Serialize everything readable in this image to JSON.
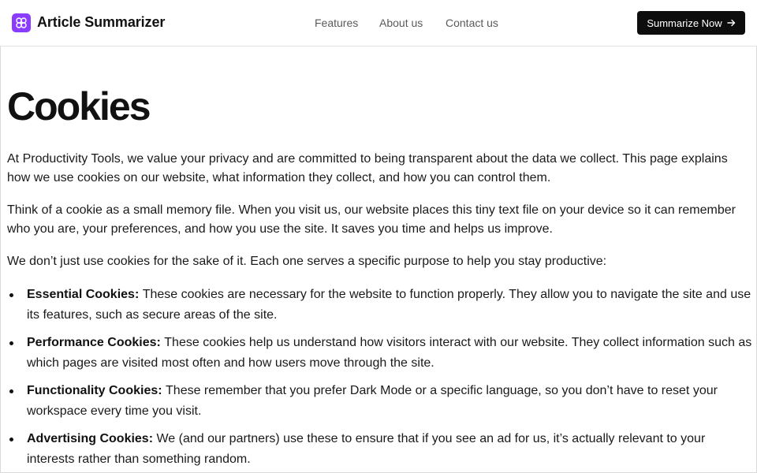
{
  "brand": {
    "name": "Article Summarizer",
    "logo_icon": "brain-icon",
    "logo_color": "#8b3dff"
  },
  "nav": {
    "links": [
      {
        "label": "Features"
      },
      {
        "label": "About us"
      },
      {
        "label": "Contact us"
      }
    ]
  },
  "cta": {
    "label": "Summarize Now",
    "icon": "arrow-right-icon"
  },
  "page": {
    "title": "Cookies",
    "paragraphs": [
      "At Productivity Tools, we value your privacy and are committed to being transparent about the data we collect. This page explains how we use cookies on our website, what information they collect, and how you can control them.",
      "Think of a cookie as a small memory file. When you visit us, our website places this tiny text file on your device so it can remember who you are, your preferences, and how you use the site. It saves you time and helps us improve.",
      "We don’t just use cookies for the sake of it. Each one serves a specific purpose to help you stay productive:"
    ],
    "cookie_types": [
      {
        "name": "Essential Cookies:",
        "description": "These cookies are necessary for the website to function properly. They allow you to navigate the site and use its features, such as secure areas of the site."
      },
      {
        "name": "Performance Cookies:",
        "description": "These cookies help us understand how visitors interact with our website. They collect information such as which pages are visited most often and how users move through the site."
      },
      {
        "name": "Functionality Cookies:",
        "description": "These remember that you prefer Dark Mode or a specific language, so you don’t have to reset your workspace every time you visit."
      },
      {
        "name": "Advertising Cookies:",
        "description": "We (and our partners) use these to ensure that if you see an ad for us, it’s actually relevant to your interests rather than something random."
      }
    ]
  }
}
